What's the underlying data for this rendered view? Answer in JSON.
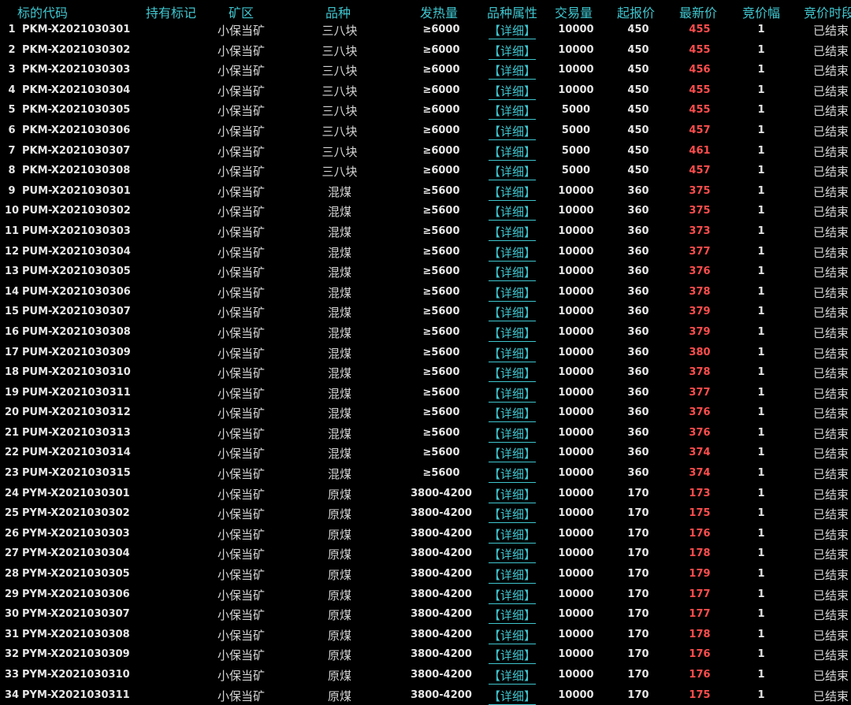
{
  "colors": {
    "header": "#3fc6cf",
    "detail_link": "#3fc6cf",
    "latest_price": "#ff4d4d",
    "text": "#e6e6e6",
    "background": "#000000"
  },
  "header": {
    "code": "标的代码",
    "hold": "持有标记",
    "mine": "矿区",
    "variety": "品种",
    "heat": "发热量",
    "attr": "品种属性",
    "volume": "交易量",
    "start_price": "起报价",
    "latest_price": "最新价",
    "step": "竞价幅",
    "period": "竞价时段"
  },
  "rows": [
    {
      "idx": "1",
      "code": "PKM-X2021030301",
      "mine": "小保当矿",
      "variety": "三八块",
      "heat": "≥6000",
      "detail": "【详细】",
      "volume": "10000",
      "start": "450",
      "latest": "455",
      "step": "1",
      "status": "已结束"
    },
    {
      "idx": "2",
      "code": "PKM-X2021030302",
      "mine": "小保当矿",
      "variety": "三八块",
      "heat": "≥6000",
      "detail": "【详细】",
      "volume": "10000",
      "start": "450",
      "latest": "455",
      "step": "1",
      "status": "已结束"
    },
    {
      "idx": "3",
      "code": "PKM-X2021030303",
      "mine": "小保当矿",
      "variety": "三八块",
      "heat": "≥6000",
      "detail": "【详细】",
      "volume": "10000",
      "start": "450",
      "latest": "456",
      "step": "1",
      "status": "已结束"
    },
    {
      "idx": "4",
      "code": "PKM-X2021030304",
      "mine": "小保当矿",
      "variety": "三八块",
      "heat": "≥6000",
      "detail": "【详细】",
      "volume": "10000",
      "start": "450",
      "latest": "455",
      "step": "1",
      "status": "已结束"
    },
    {
      "idx": "5",
      "code": "PKM-X2021030305",
      "mine": "小保当矿",
      "variety": "三八块",
      "heat": "≥6000",
      "detail": "【详细】",
      "volume": "5000",
      "start": "450",
      "latest": "455",
      "step": "1",
      "status": "已结束"
    },
    {
      "idx": "6",
      "code": "PKM-X2021030306",
      "mine": "小保当矿",
      "variety": "三八块",
      "heat": "≥6000",
      "detail": "【详细】",
      "volume": "5000",
      "start": "450",
      "latest": "457",
      "step": "1",
      "status": "已结束"
    },
    {
      "idx": "7",
      "code": "PKM-X2021030307",
      "mine": "小保当矿",
      "variety": "三八块",
      "heat": "≥6000",
      "detail": "【详细】",
      "volume": "5000",
      "start": "450",
      "latest": "461",
      "step": "1",
      "status": "已结束"
    },
    {
      "idx": "8",
      "code": "PKM-X2021030308",
      "mine": "小保当矿",
      "variety": "三八块",
      "heat": "≥6000",
      "detail": "【详细】",
      "volume": "5000",
      "start": "450",
      "latest": "457",
      "step": "1",
      "status": "已结束"
    },
    {
      "idx": "9",
      "code": "PUM-X2021030301",
      "mine": "小保当矿",
      "variety": "混煤",
      "heat": "≥5600",
      "detail": "【详细】",
      "volume": "10000",
      "start": "360",
      "latest": "375",
      "step": "1",
      "status": "已结束"
    },
    {
      "idx": "10",
      "code": "PUM-X2021030302",
      "mine": "小保当矿",
      "variety": "混煤",
      "heat": "≥5600",
      "detail": "【详细】",
      "volume": "10000",
      "start": "360",
      "latest": "375",
      "step": "1",
      "status": "已结束"
    },
    {
      "idx": "11",
      "code": "PUM-X2021030303",
      "mine": "小保当矿",
      "variety": "混煤",
      "heat": "≥5600",
      "detail": "【详细】",
      "volume": "10000",
      "start": "360",
      "latest": "373",
      "step": "1",
      "status": "已结束"
    },
    {
      "idx": "12",
      "code": "PUM-X2021030304",
      "mine": "小保当矿",
      "variety": "混煤",
      "heat": "≥5600",
      "detail": "【详细】",
      "volume": "10000",
      "start": "360",
      "latest": "377",
      "step": "1",
      "status": "已结束"
    },
    {
      "idx": "13",
      "code": "PUM-X2021030305",
      "mine": "小保当矿",
      "variety": "混煤",
      "heat": "≥5600",
      "detail": "【详细】",
      "volume": "10000",
      "start": "360",
      "latest": "376",
      "step": "1",
      "status": "已结束"
    },
    {
      "idx": "14",
      "code": "PUM-X2021030306",
      "mine": "小保当矿",
      "variety": "混煤",
      "heat": "≥5600",
      "detail": "【详细】",
      "volume": "10000",
      "start": "360",
      "latest": "378",
      "step": "1",
      "status": "已结束"
    },
    {
      "idx": "15",
      "code": "PUM-X2021030307",
      "mine": "小保当矿",
      "variety": "混煤",
      "heat": "≥5600",
      "detail": "【详细】",
      "volume": "10000",
      "start": "360",
      "latest": "379",
      "step": "1",
      "status": "已结束"
    },
    {
      "idx": "16",
      "code": "PUM-X2021030308",
      "mine": "小保当矿",
      "variety": "混煤",
      "heat": "≥5600",
      "detail": "【详细】",
      "volume": "10000",
      "start": "360",
      "latest": "379",
      "step": "1",
      "status": "已结束"
    },
    {
      "idx": "17",
      "code": "PUM-X2021030309",
      "mine": "小保当矿",
      "variety": "混煤",
      "heat": "≥5600",
      "detail": "【详细】",
      "volume": "10000",
      "start": "360",
      "latest": "380",
      "step": "1",
      "status": "已结束"
    },
    {
      "idx": "18",
      "code": "PUM-X2021030310",
      "mine": "小保当矿",
      "variety": "混煤",
      "heat": "≥5600",
      "detail": "【详细】",
      "volume": "10000",
      "start": "360",
      "latest": "378",
      "step": "1",
      "status": "已结束"
    },
    {
      "idx": "19",
      "code": "PUM-X2021030311",
      "mine": "小保当矿",
      "variety": "混煤",
      "heat": "≥5600",
      "detail": "【详细】",
      "volume": "10000",
      "start": "360",
      "latest": "377",
      "step": "1",
      "status": "已结束"
    },
    {
      "idx": "20",
      "code": "PUM-X2021030312",
      "mine": "小保当矿",
      "variety": "混煤",
      "heat": "≥5600",
      "detail": "【详细】",
      "volume": "10000",
      "start": "360",
      "latest": "376",
      "step": "1",
      "status": "已结束"
    },
    {
      "idx": "21",
      "code": "PUM-X2021030313",
      "mine": "小保当矿",
      "variety": "混煤",
      "heat": "≥5600",
      "detail": "【详细】",
      "volume": "10000",
      "start": "360",
      "latest": "376",
      "step": "1",
      "status": "已结束"
    },
    {
      "idx": "22",
      "code": "PUM-X2021030314",
      "mine": "小保当矿",
      "variety": "混煤",
      "heat": "≥5600",
      "detail": "【详细】",
      "volume": "10000",
      "start": "360",
      "latest": "374",
      "step": "1",
      "status": "已结束"
    },
    {
      "idx": "23",
      "code": "PUM-X2021030315",
      "mine": "小保当矿",
      "variety": "混煤",
      "heat": "≥5600",
      "detail": "【详细】",
      "volume": "10000",
      "start": "360",
      "latest": "374",
      "step": "1",
      "status": "已结束"
    },
    {
      "idx": "24",
      "code": "PYM-X2021030301",
      "mine": "小保当矿",
      "variety": "原煤",
      "heat": "3800-4200",
      "detail": "【详细】",
      "volume": "10000",
      "start": "170",
      "latest": "173",
      "step": "1",
      "status": "已结束"
    },
    {
      "idx": "25",
      "code": "PYM-X2021030302",
      "mine": "小保当矿",
      "variety": "原煤",
      "heat": "3800-4200",
      "detail": "【详细】",
      "volume": "10000",
      "start": "170",
      "latest": "175",
      "step": "1",
      "status": "已结束"
    },
    {
      "idx": "26",
      "code": "PYM-X2021030303",
      "mine": "小保当矿",
      "variety": "原煤",
      "heat": "3800-4200",
      "detail": "【详细】",
      "volume": "10000",
      "start": "170",
      "latest": "176",
      "step": "1",
      "status": "已结束"
    },
    {
      "idx": "27",
      "code": "PYM-X2021030304",
      "mine": "小保当矿",
      "variety": "原煤",
      "heat": "3800-4200",
      "detail": "【详细】",
      "volume": "10000",
      "start": "170",
      "latest": "178",
      "step": "1",
      "status": "已结束"
    },
    {
      "idx": "28",
      "code": "PYM-X2021030305",
      "mine": "小保当矿",
      "variety": "原煤",
      "heat": "3800-4200",
      "detail": "【详细】",
      "volume": "10000",
      "start": "170",
      "latest": "179",
      "step": "1",
      "status": "已结束"
    },
    {
      "idx": "29",
      "code": "PYM-X2021030306",
      "mine": "小保当矿",
      "variety": "原煤",
      "heat": "3800-4200",
      "detail": "【详细】",
      "volume": "10000",
      "start": "170",
      "latest": "177",
      "step": "1",
      "status": "已结束"
    },
    {
      "idx": "30",
      "code": "PYM-X2021030307",
      "mine": "小保当矿",
      "variety": "原煤",
      "heat": "3800-4200",
      "detail": "【详细】",
      "volume": "10000",
      "start": "170",
      "latest": "177",
      "step": "1",
      "status": "已结束"
    },
    {
      "idx": "31",
      "code": "PYM-X2021030308",
      "mine": "小保当矿",
      "variety": "原煤",
      "heat": "3800-4200",
      "detail": "【详细】",
      "volume": "10000",
      "start": "170",
      "latest": "178",
      "step": "1",
      "status": "已结束"
    },
    {
      "idx": "32",
      "code": "PYM-X2021030309",
      "mine": "小保当矿",
      "variety": "原煤",
      "heat": "3800-4200",
      "detail": "【详细】",
      "volume": "10000",
      "start": "170",
      "latest": "176",
      "step": "1",
      "status": "已结束"
    },
    {
      "idx": "33",
      "code": "PYM-X2021030310",
      "mine": "小保当矿",
      "variety": "原煤",
      "heat": "3800-4200",
      "detail": "【详细】",
      "volume": "10000",
      "start": "170",
      "latest": "176",
      "step": "1",
      "status": "已结束"
    },
    {
      "idx": "34",
      "code": "PYM-X2021030311",
      "mine": "小保当矿",
      "variety": "原煤",
      "heat": "3800-4200",
      "detail": "【详细】",
      "volume": "10000",
      "start": "170",
      "latest": "175",
      "step": "1",
      "status": "已结束"
    }
  ]
}
